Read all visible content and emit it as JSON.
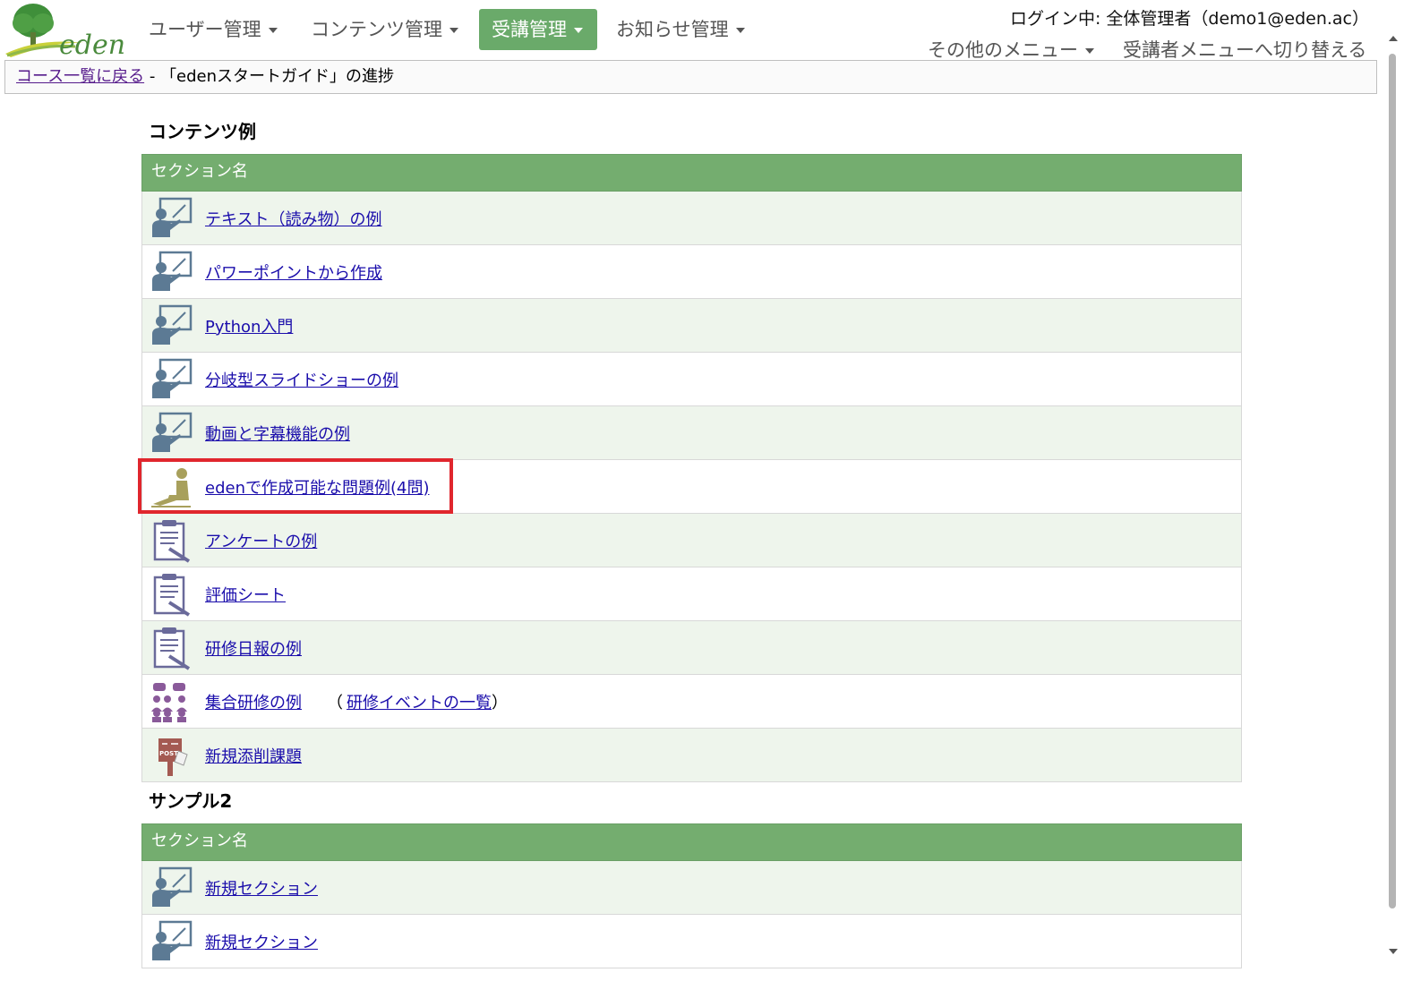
{
  "header": {
    "logo_text": "eden",
    "nav": [
      {
        "label": "ユーザー管理"
      },
      {
        "label": "コンテンツ管理"
      },
      {
        "label": "受講管理",
        "active": true
      },
      {
        "label": "お知らせ管理"
      }
    ],
    "login_text": "ログイン中: 全体管理者（demo1@eden.ac）",
    "other_menu": "その他のメニュー",
    "switch_menu": "受講者メニューへ切り替える"
  },
  "breadcrumb": {
    "back_link": "コース一覧に戻る",
    "separator": " - ",
    "current": "「edenスタートガイド」の進捗"
  },
  "courses": [
    {
      "title": "コンテンツ例",
      "section_header": "セクション名",
      "items": [
        {
          "label": "テキスト（読み物）の例",
          "icon": "lecture-icon"
        },
        {
          "label": "パワーポイントから作成",
          "icon": "lecture-icon"
        },
        {
          "label": "Python入門",
          "icon": "lecture-icon"
        },
        {
          "label": "分岐型スライドショーの例",
          "icon": "lecture-icon"
        },
        {
          "label": "動画と字幕機能の例",
          "icon": "lecture-icon"
        },
        {
          "label": "edenで作成可能な問題例(4問)",
          "icon": "exam-icon",
          "highlighted": true
        },
        {
          "label": "アンケートの例",
          "icon": "survey-icon"
        },
        {
          "label": "評価シート",
          "icon": "survey-icon"
        },
        {
          "label": "研修日報の例",
          "icon": "survey-icon"
        },
        {
          "label": "集合研修の例",
          "icon": "group-training-icon",
          "extra_open": "（",
          "extra_link": "研修イベントの一覧",
          "extra_close": "）"
        },
        {
          "label": "新規添削課題",
          "icon": "post-icon",
          "post_text": "POST"
        }
      ]
    },
    {
      "title": "サンプル2",
      "section_header": "セクション名",
      "items": [
        {
          "label": "新規セクション",
          "icon": "lecture-icon"
        },
        {
          "label": "新規セクション",
          "icon": "lecture-icon"
        }
      ]
    }
  ],
  "colors": {
    "accent_green": "#74ad6f",
    "nav_active": "#6aaa6a",
    "row_alt": "#eef5ec",
    "link": "#1a0dab",
    "highlight": "#e0262d"
  }
}
